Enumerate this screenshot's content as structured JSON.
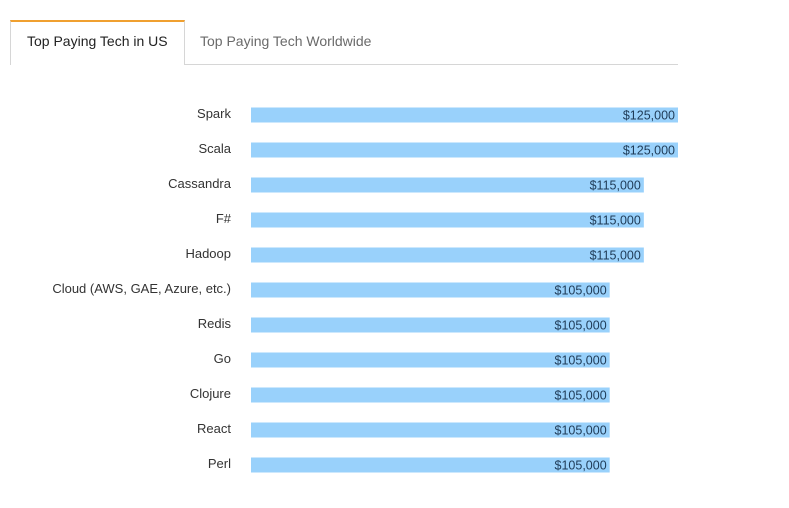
{
  "tabs": [
    {
      "label": "Top Paying Tech in US",
      "active": true
    },
    {
      "label": "Top Paying Tech Worldwide",
      "active": false
    }
  ],
  "colors": {
    "bar": "#99d1fb",
    "tab_accent": "#f0a030"
  },
  "chart_data": {
    "type": "bar",
    "orientation": "horizontal",
    "categories": [
      "Spark",
      "Scala",
      "Cassandra",
      "F#",
      "Hadoop",
      "Cloud (AWS, GAE, Azure, etc.)",
      "Redis",
      "Go",
      "Clojure",
      "React",
      "Perl"
    ],
    "values": [
      125000,
      125000,
      115000,
      115000,
      115000,
      105000,
      105000,
      105000,
      105000,
      105000,
      105000
    ],
    "value_labels": [
      "$125,000",
      "$125,000",
      "$115,000",
      "$115,000",
      "$115,000",
      "$105,000",
      "$105,000",
      "$105,000",
      "$105,000",
      "$105,000",
      "$105,000"
    ],
    "xlim": [
      0,
      125000
    ],
    "grid": false,
    "legend": "none"
  }
}
